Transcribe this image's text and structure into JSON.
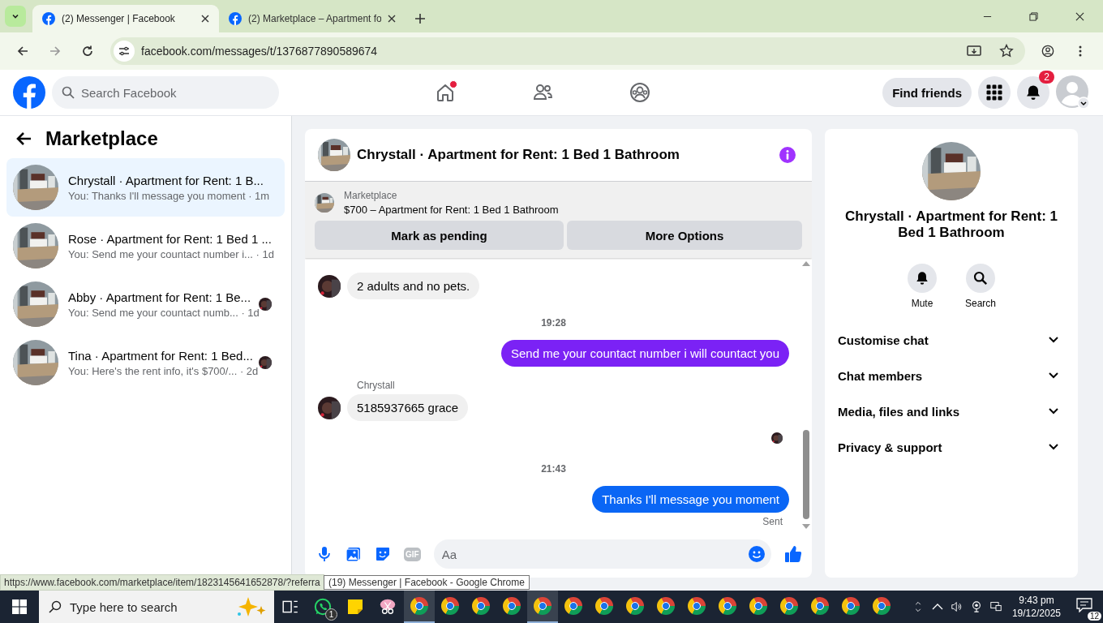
{
  "browser": {
    "tabs": [
      {
        "title": "(2) Messenger | Facebook",
        "selected": true
      },
      {
        "title": "(2) Marketplace – Apartment fo",
        "selected": false
      }
    ],
    "url": "facebook.com/messages/t/1376877890589674"
  },
  "header": {
    "search_placeholder": "Search Facebook",
    "nav": [
      {
        "kind": "home",
        "dot": true
      },
      {
        "kind": "friends",
        "dot": false
      },
      {
        "kind": "groups",
        "dot": false
      }
    ],
    "find_friends": "Find friends",
    "notification_badge": "2"
  },
  "sidebar": {
    "title": "Marketplace",
    "conversations": [
      {
        "title": "Chrystall · Apartment for Rent: 1 B...",
        "preview": "You: Thanks I'll message you moment · 1m",
        "selected": true,
        "seen_avatar": false
      },
      {
        "title": "Rose · Apartment for Rent: 1 Bed 1 ...",
        "preview": "You: Send me your countact number i... · 1d",
        "selected": false,
        "seen_avatar": false
      },
      {
        "title": "Abby · Apartment for Rent: 1 Be...",
        "preview": "You: Send me your countact numb... · 1d",
        "selected": false,
        "seen_avatar": true
      },
      {
        "title": "Tina · Apartment for Rent: 1 Bed...",
        "preview": "You: Here's the rent info, it's $700/... · 2d",
        "selected": false,
        "seen_avatar": true
      }
    ]
  },
  "chat": {
    "title": "Chrystall · Apartment for Rent: 1 Bed 1 Bathroom",
    "listing": {
      "source": "Marketplace",
      "name": "$700 – Apartment for Rent: 1 Bed 1 Bathroom"
    },
    "actions": [
      "Mark as pending",
      "More Options"
    ],
    "messages": [
      {
        "kind": "received",
        "text": "2 adults and no pets."
      },
      {
        "kind": "time",
        "text": "19:28"
      },
      {
        "kind": "sent",
        "text": "Send me your countact number i will countact you",
        "color": "#7b22f5"
      },
      {
        "kind": "sender",
        "text": "Chrystall"
      },
      {
        "kind": "received",
        "text": "5185937665 grace"
      },
      {
        "kind": "seen"
      },
      {
        "kind": "time",
        "text": "21:43"
      },
      {
        "kind": "sent",
        "text": "Thanks I'll message you moment",
        "color": "#0a66f5"
      },
      {
        "kind": "status",
        "text": "Sent"
      }
    ],
    "gif_label": "GIF",
    "composer_placeholder": "Aa"
  },
  "details": {
    "title": "Chrystall · Apartment for Rent: 1 Bed 1 Bathroom",
    "actions": [
      {
        "kind": "mute",
        "label": "Mute"
      },
      {
        "kind": "search",
        "label": "Search"
      }
    ],
    "sections": [
      {
        "label": "Customise chat",
        "expanded": false
      },
      {
        "label": "Chat members",
        "expanded": false
      },
      {
        "label": "Media, files and links",
        "expanded": false
      },
      {
        "label": "Privacy & support",
        "expanded": false
      }
    ]
  },
  "status_url": "https://www.facebook.com/marketplace/item/1823145641652878/?referra",
  "tooltip": "(19) Messenger | Facebook - Google Chrome",
  "taskbar": {
    "search_placeholder": "Type here to search",
    "whatsapp_badge": "1",
    "apps": [
      {
        "active": true
      },
      {
        "active": false
      },
      {
        "active": false
      },
      {
        "active": false
      },
      {
        "active": true
      },
      {
        "active": false
      },
      {
        "active": false
      },
      {
        "active": false
      },
      {
        "active": false
      },
      {
        "active": false
      },
      {
        "active": false
      },
      {
        "active": false
      },
      {
        "active": false
      },
      {
        "active": false
      },
      {
        "active": false
      },
      {
        "active": false
      }
    ],
    "time": "9:43 pm",
    "date": "19/12/2025",
    "notification_count": "12"
  }
}
